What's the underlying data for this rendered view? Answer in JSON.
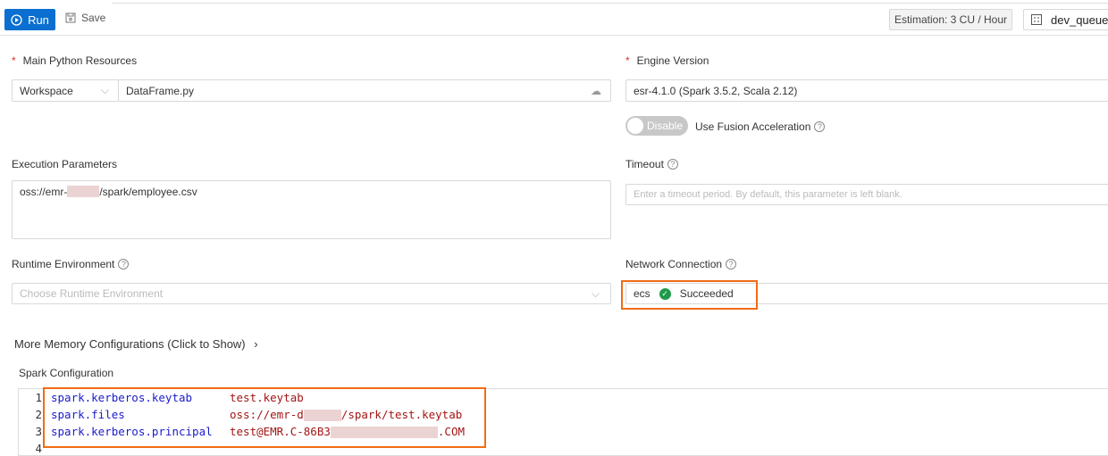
{
  "toolbar": {
    "run": "Run",
    "save": "Save",
    "estimation": "Estimation: 3 CU / Hour",
    "queue": "dev_queue"
  },
  "main_python": {
    "label": "Main Python Resources",
    "source": "Workspace",
    "file": "DataFrame.py"
  },
  "engine": {
    "label": "Engine Version",
    "value": "esr-4.1.0 (Spark 3.5.2, Scala 2.12)",
    "fusion_toggle": "Disable",
    "fusion_label": "Use Fusion Acceleration"
  },
  "exec_params": {
    "label": "Execution Parameters",
    "value_prefix": "oss://emr-",
    "value_suffix": "/spark/employee.csv"
  },
  "timeout": {
    "label": "Timeout",
    "placeholder": "Enter a timeout period. By default, this parameter is left blank."
  },
  "runtime": {
    "label": "Runtime Environment",
    "placeholder": "Choose Runtime Environment"
  },
  "network": {
    "label": "Network Connection",
    "value": "ecs",
    "status": "Succeeded"
  },
  "memory": {
    "label": "More Memory Configurations (Click to Show)"
  },
  "spark_config": {
    "label": "Spark Configuration",
    "lines": [
      {
        "n": "1",
        "key": "spark.kerberos.keytab",
        "val": "test.keytab",
        "val2": ""
      },
      {
        "n": "2",
        "key": "spark.files",
        "val": "oss://emr-d",
        "val2": "/spark/test.keytab"
      },
      {
        "n": "3",
        "key": "spark.kerberos.principal",
        "val": "test@EMR.C-86B3",
        "val2": ".COM"
      },
      {
        "n": "4",
        "key": "",
        "val": "",
        "val2": ""
      }
    ]
  }
}
